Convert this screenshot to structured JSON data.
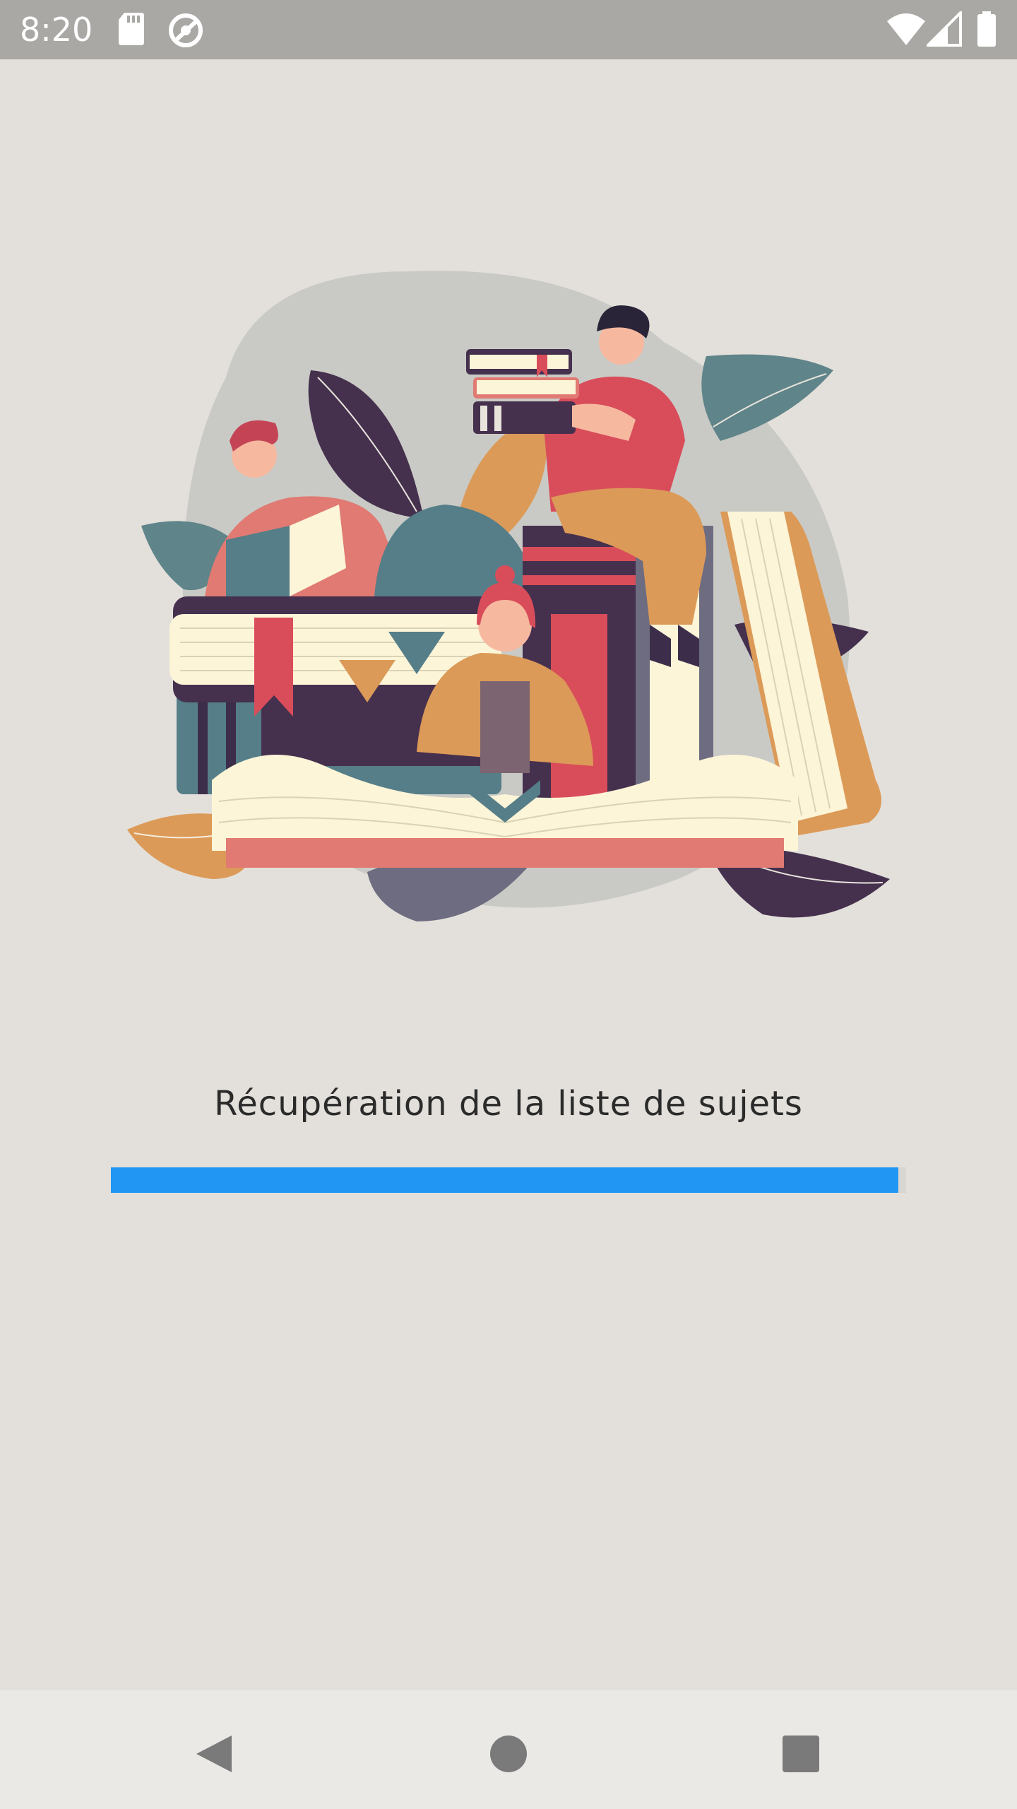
{
  "status_bar": {
    "time": "8:20",
    "icons": [
      "sd-card-icon",
      "data-saver-icon",
      "wifi-icon",
      "signal-icon",
      "battery-icon"
    ]
  },
  "loading": {
    "message": "Récupération de la liste de sujets",
    "progress_percent": 99
  },
  "nav_bar": {
    "buttons": [
      "back-icon",
      "home-icon",
      "recents-icon"
    ]
  },
  "colors": {
    "background": "#e3e0db",
    "progress": "#2196f3",
    "status_bar": "#a9a8a4"
  }
}
